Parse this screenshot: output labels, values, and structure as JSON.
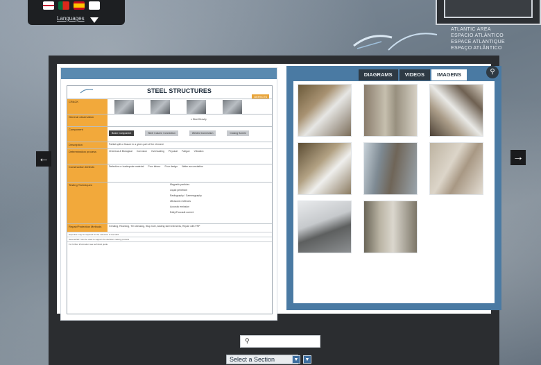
{
  "languages": {
    "label": "Languages",
    "flags": [
      "uk-flag-icon",
      "pt-flag-icon",
      "es-flag-icon",
      "fr-flag-icon"
    ]
  },
  "brand": {
    "line1": "ATLANTIC AREA",
    "line2": "ESPACIO ATLÁNTICO",
    "line3": "ESPACE ATLANTIQUE",
    "line4": "ESPAÇO ATLÂNTICO"
  },
  "document": {
    "title": "STEEL STRUCTURES",
    "subtitle": "DEFECTS",
    "rows": [
      {
        "label": "CRACK",
        "cells": []
      },
      {
        "label": "General observation",
        "cells": [
          "",
          "",
          "",
          "x  Steel/Gravity",
          "",
          ""
        ]
      },
      {
        "label": "Component",
        "cells": [
          "Beam Component",
          "Steel Column Connection",
          "Welded Connection",
          "Closing Screen"
        ]
      },
      {
        "label": "Description",
        "cells": [
          "Partial split or fissure in a given part of the element"
        ]
      },
      {
        "label": "Determination process",
        "cells": [
          "Chemical & Biological",
          "Corrosion",
          "Overloading",
          "Physical",
          "Fatigue",
          "Vibration"
        ]
      },
      {
        "label": "Construction Defects",
        "cells": [
          "Defective or inadequate material",
          "Poor labour",
          "Poor design",
          "Water accumulation"
        ]
      },
      {
        "label": "Testing Techniques",
        "cells": [
          "Magnetic particles",
          "Liquid penetrant",
          "Radiography / Gammagraphy",
          "Ultrasonic methods",
          "Acoustic emission",
          "Eddy/Foucault current"
        ]
      },
      {
        "label": "Repair/Protection Methods",
        "cells": [
          "Grinding, Reaming, TIG dressing, Stop hole, Adding steel elements, Repair with FRP"
        ]
      }
    ],
    "notes": [
      "Expertise may be required for the selection of the NDT",
      "Several NDT can be used to support the decision making process",
      "For further information see technical guide."
    ]
  },
  "gallery": {
    "tabs": [
      "DIAGRAMS",
      "VIDEOS",
      "IMAGENS"
    ],
    "active_tab": "IMAGENS",
    "images": [
      "steel-crack-photo-1",
      "steel-crack-photo-2",
      "steel-crack-photo-3",
      "steel-crack-photo-4",
      "steel-crack-photo-5",
      "steel-crack-photo-6",
      "steel-crack-photo-7",
      "steel-crack-photo-8"
    ]
  },
  "footer": {
    "search_placeholder": "",
    "section_select": "Select a Section"
  },
  "colors": {
    "accent_blue": "#4a7aa3",
    "dark_frame": "#2b2d30",
    "orange": "#f2a93b"
  }
}
